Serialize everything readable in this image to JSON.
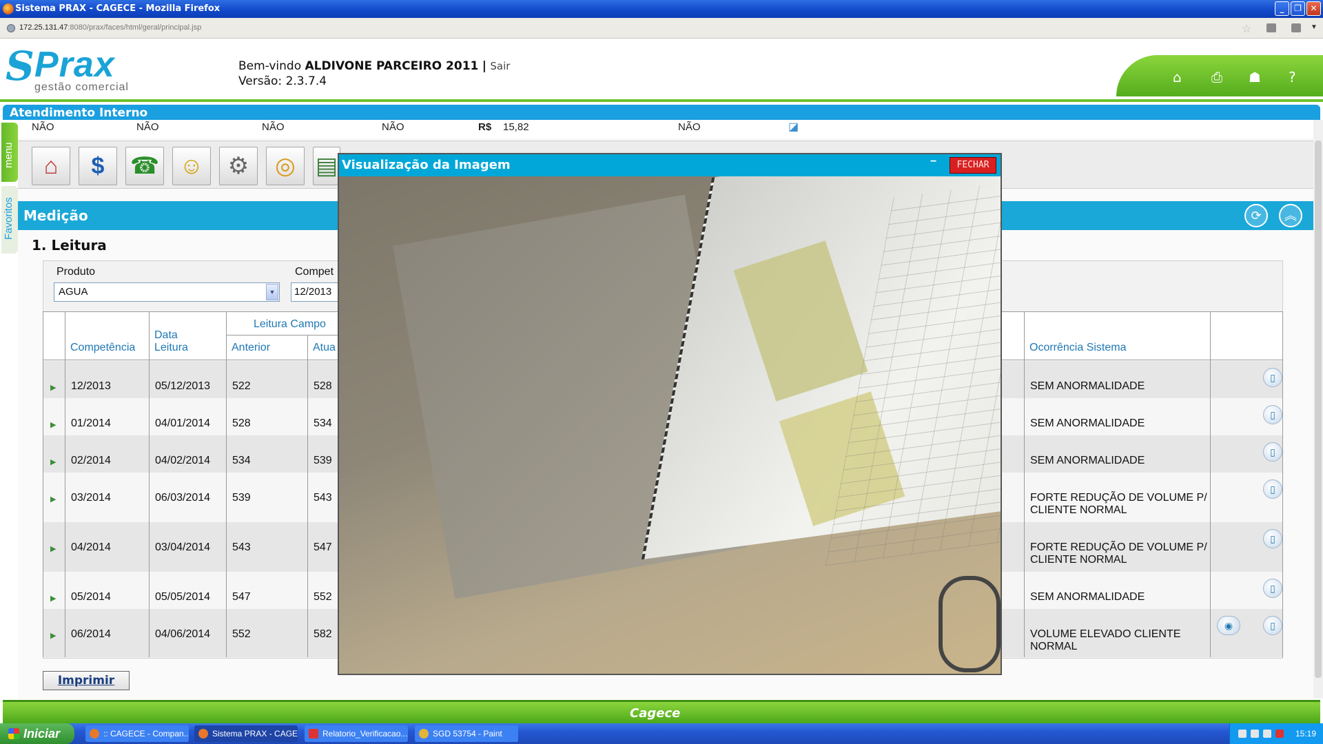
{
  "window": {
    "title": "Sistema PRAX - CAGECE - Mozilla Firefox",
    "controls": [
      "_",
      "❐",
      "✕"
    ]
  },
  "address": {
    "host": "172.25.131.47",
    "rest": ":8080/prax/faces/html/geral/principal.jsp"
  },
  "header": {
    "logo": "Prax",
    "logo_sub": "gestão comercial",
    "welcome_prefix": "Bem-vindo",
    "user": "ALDIVONE PARCEIRO 2011",
    "separator": "|",
    "logout": "Sair",
    "version": "Versão: 2.3.7.4",
    "icons": [
      "home-icon",
      "print-icon",
      "sitemap-icon",
      "help-icon"
    ]
  },
  "section": {
    "title": "Atendimento Interno"
  },
  "sidetabs": {
    "menu": "menu",
    "favoritos": "Favoritos"
  },
  "status_row": {
    "v1": "NÃO",
    "v2": "NÃO",
    "v3": "NÃO",
    "v4": "NÃO",
    "currency": "R$",
    "amount": "15,82",
    "v5": "NÃO"
  },
  "toolbar_icons": [
    "house-icon",
    "dollar-icon",
    "phone-icon",
    "smiley-icon",
    "meter-icon",
    "coins-icon",
    "money-icon"
  ],
  "medicao": {
    "title": "Medição",
    "subtitle": "1. Leitura"
  },
  "form": {
    "produto_label": "Produto",
    "produto_value": "AGUA",
    "competencia_label": "Compet",
    "competencia_value": "12/2013"
  },
  "table": {
    "headers": {
      "competencia": "Competência",
      "data_leitura_1": "Data",
      "data_leitura_2": "Leitura",
      "leitura_campo": "Leitura Campo",
      "anterior": "Anterior",
      "atual": "Atua",
      "ocorrencia": "Ocorrência Sistema"
    },
    "rows": [
      {
        "competencia": "12/2013",
        "data": "05/12/2013",
        "anterior": "522",
        "atual": "528",
        "ocorrencia": "SEM ANORMALIDADE",
        "ocorrencia2": "",
        "camera": false
      },
      {
        "competencia": "01/2014",
        "data": "04/01/2014",
        "anterior": "528",
        "atual": "534",
        "ocorrencia": "SEM ANORMALIDADE",
        "ocorrencia2": "",
        "camera": false
      },
      {
        "competencia": "02/2014",
        "data": "04/02/2014",
        "anterior": "534",
        "atual": "539",
        "ocorrencia": "SEM ANORMALIDADE",
        "ocorrencia2": "",
        "camera": false
      },
      {
        "competencia": "03/2014",
        "data": "06/03/2014",
        "anterior": "539",
        "atual": "543",
        "ocorrencia": "FORTE REDUÇÃO DE VOLUME P/",
        "ocorrencia2": "CLIENTE NORMAL",
        "camera": false
      },
      {
        "competencia": "04/2014",
        "data": "03/04/2014",
        "anterior": "543",
        "atual": "547",
        "ocorrencia": "FORTE REDUÇÃO DE VOLUME P/",
        "ocorrencia2": "CLIENTE NORMAL",
        "camera": false
      },
      {
        "competencia": "05/2014",
        "data": "05/05/2014",
        "anterior": "547",
        "atual": "552",
        "ocorrencia": "SEM ANORMALIDADE",
        "ocorrencia2": "",
        "camera": false
      },
      {
        "competencia": "06/2014",
        "data": "04/06/2014",
        "anterior": "552",
        "atual": "582",
        "ocorrencia": "VOLUME ELEVADO CLIENTE",
        "ocorrencia2": "NORMAL",
        "camera": true
      }
    ]
  },
  "buttons": {
    "imprimir": "Imprimir"
  },
  "footer": {
    "brand": "Cagece"
  },
  "modal": {
    "title": "Visualização da Imagem",
    "minimize": "−",
    "close": "FECHAR"
  },
  "taskbar": {
    "start": "Iniciar",
    "tasks": [
      ":: CAGECE - Compan...",
      "Sistema PRAX - CAGE...",
      "Relatorio_Verificacao...",
      "SGD 53754 - Paint"
    ],
    "clock": "15:19"
  }
}
